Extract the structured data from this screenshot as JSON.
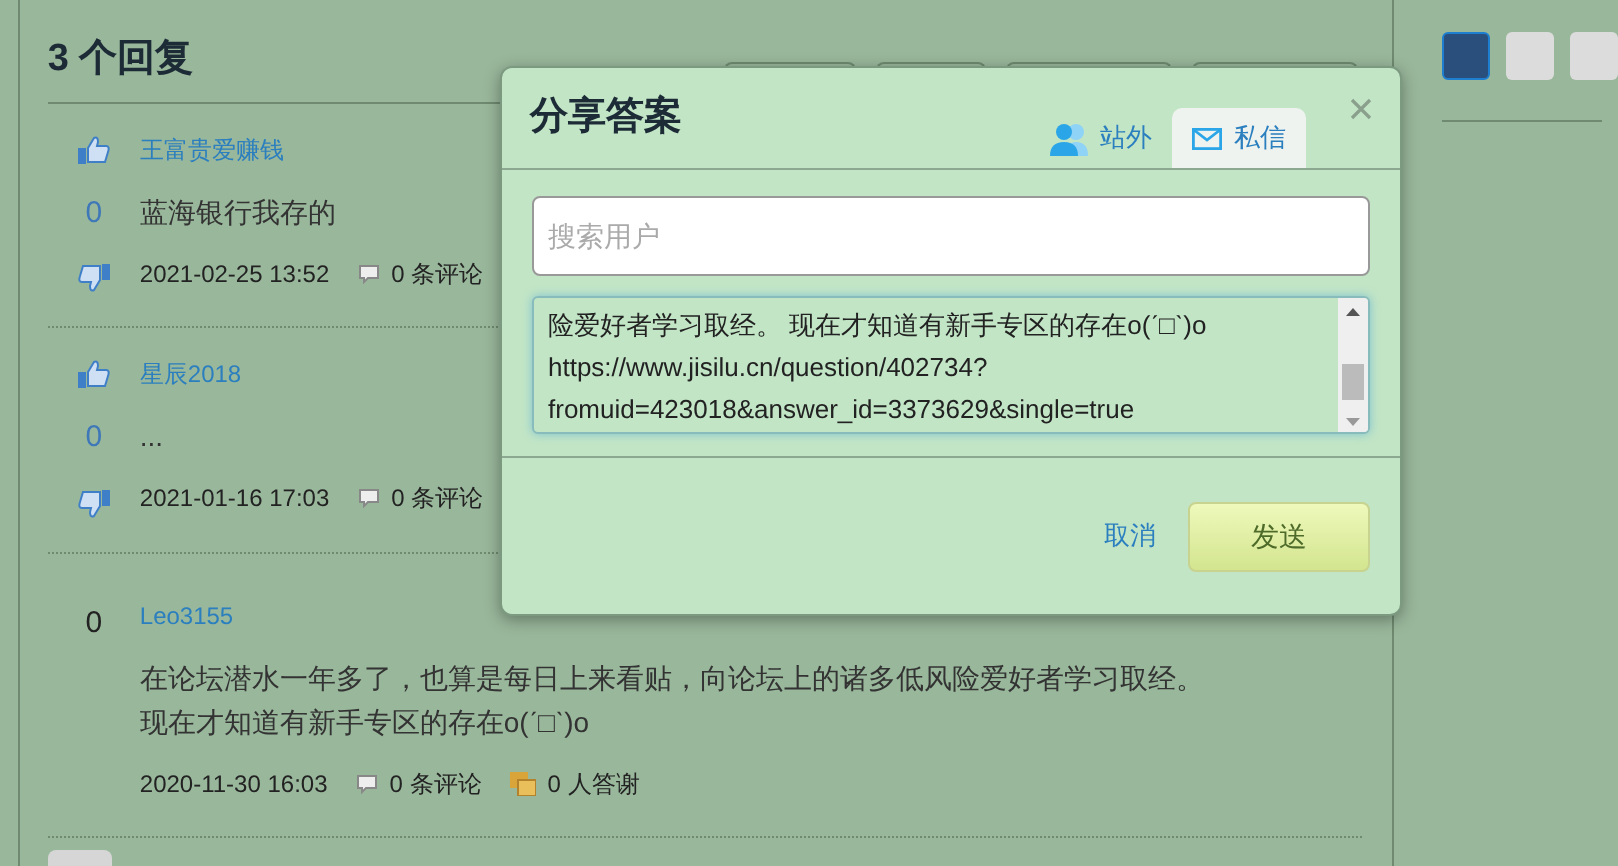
{
  "answers_heading": "3 个回复",
  "answers": [
    {
      "author": "王富贵爱赚钱",
      "votes": "0",
      "vote_arrows": true,
      "body": [
        "蓝海银行我存的"
      ],
      "time": "2021-02-25 13:52",
      "comments": "0 条评论"
    },
    {
      "author": "星辰2018",
      "votes": "0",
      "vote_arrows": true,
      "body": [
        "..."
      ],
      "time": "2021-01-16 17:03",
      "comments": "0 条评论"
    },
    {
      "author": "Leo3155",
      "votes": "0",
      "vote_arrows": false,
      "body": [
        "在论坛潜水一年多了，也算是每日上来看贴，向论坛上的诸多低风险爱好者学习取经。",
        "现在才知道有新手专区的存在o(ˊ□ˋ)o"
      ],
      "time": "2020-11-30 16:03",
      "comments": "0 条评论",
      "thanks": "0 人答谢"
    }
  ],
  "share_dialog": {
    "title": "分享答案",
    "tabs": [
      {
        "label": "站外",
        "selected": false,
        "kind": "people"
      },
      {
        "label": "私信",
        "selected": true,
        "kind": "mail"
      }
    ],
    "search": {
      "placeholder": "搜索用户"
    },
    "message_lines": [
      "险爱好者学习取经。 现在才知道有新手专区的存在o(ˊ□ˋ)o",
      "https://www.jisilu.cn/question/402734?",
      "fromuid=423018&answer_id=3373629&single=true"
    ],
    "cancel": "取消",
    "send": "发送"
  }
}
